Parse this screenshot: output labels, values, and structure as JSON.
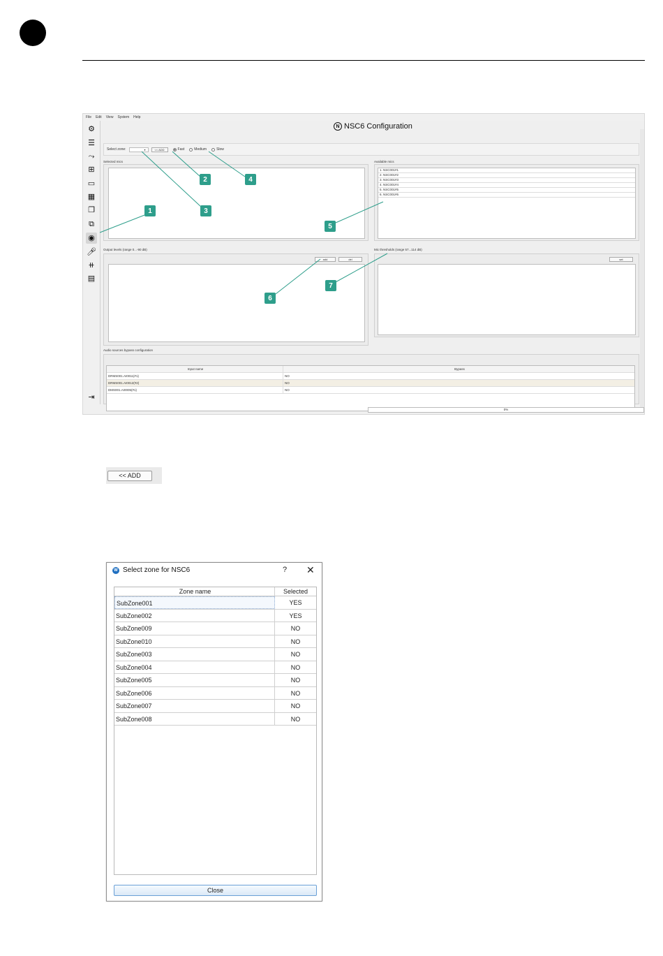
{
  "app": {
    "menu": [
      "File",
      "Edit",
      "View",
      "System",
      "Help"
    ],
    "title": "NSC6 Configuration",
    "toolbar_icons": [
      "gear-icon",
      "server-icon",
      "route-icon",
      "matrix-icon",
      "device-icon",
      "grid-icon",
      "layers-icon",
      "group-icon",
      "nsc-icon",
      "mic-icon",
      "mixer-icon",
      "document-icon",
      "exit-icon"
    ],
    "zone": {
      "label": "Select zone:",
      "add_button": "<< ADD",
      "speed_options": [
        "Fast",
        "Medium",
        "Slow"
      ],
      "speed_selected": "Fast"
    },
    "selected_mics_label": "Selected mics",
    "available_mics_label": "Available mics",
    "available_mics": [
      "1. NSC001#1",
      "2. NSC001#2",
      "3. NSC001#3",
      "4. NSC001#4",
      "5. NSC001#5",
      "6. NSC001#6"
    ],
    "output_levels_label": "Output levels (range 0...-90 dB)",
    "output_add": "add",
    "output_del": "del",
    "thresholds_label": "Mic thresholds (range 57...114 dB)",
    "thresholds_set": "set",
    "bypass_label": "Audio sources bypass configuration",
    "bypass_headers": [
      "Input name",
      "Bypass"
    ],
    "bypass_rows": [
      [
        "DRMS001.AI0011(#1)",
        "NO"
      ],
      [
        "DRMS001.AI0012(#2)",
        "NO"
      ],
      [
        "DMS001.AI0005(#1)",
        "NO"
      ]
    ],
    "progress": "0%"
  },
  "callouts": [
    "1",
    "2",
    "3",
    "4",
    "5",
    "6",
    "7"
  ],
  "add_sample_label": "<< ADD",
  "dialog": {
    "title": "Select zone for NSC6",
    "help": "?",
    "close_x": "✕",
    "headers": [
      "Zone name",
      "Selected"
    ],
    "rows": [
      [
        "SubZone001",
        "YES"
      ],
      [
        "SubZone002",
        "YES"
      ],
      [
        "SubZone009",
        "NO"
      ],
      [
        "SubZone010",
        "NO"
      ],
      [
        "SubZone003",
        "NO"
      ],
      [
        "SubZone004",
        "NO"
      ],
      [
        "SubZone005",
        "NO"
      ],
      [
        "SubZone006",
        "NO"
      ],
      [
        "SubZone007",
        "NO"
      ],
      [
        "SubZone008",
        "NO"
      ]
    ],
    "close_button": "Close"
  }
}
